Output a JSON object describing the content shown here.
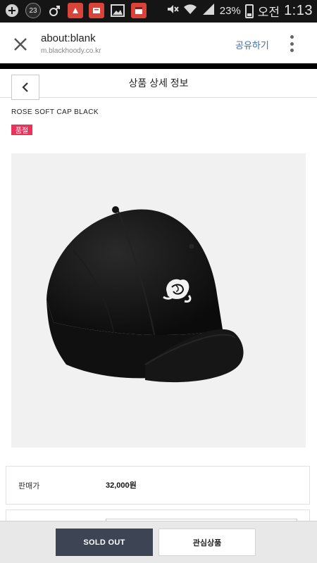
{
  "status_bar": {
    "notification_count": "23",
    "battery": "23%",
    "ampm": "오전",
    "time": "1:13"
  },
  "browser": {
    "title": "about:blank",
    "url": "m.blackhoody.co.kr",
    "share_label": "공유하기"
  },
  "page": {
    "title": "상품 상세 정보"
  },
  "product": {
    "name": "ROSE SOFT CAP BLACK",
    "badge": "품절",
    "badge_color": "#e8345b",
    "price_label": "판매가",
    "price": "32,000원"
  },
  "actions": {
    "sold_out_label": "SOLD OUT",
    "wishlist_label": "관심상품"
  },
  "colors": {
    "sold_out_button": "#3d4555",
    "share_link": "#3b6ea5"
  }
}
